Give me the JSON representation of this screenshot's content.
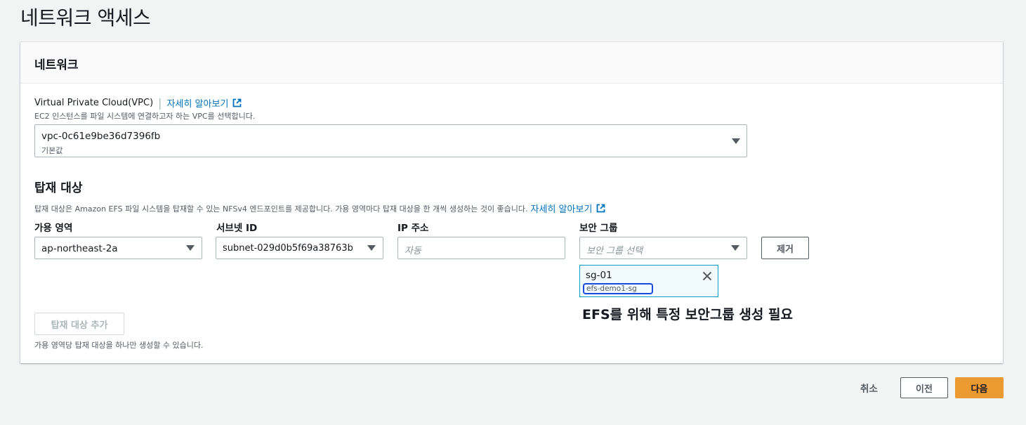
{
  "page": {
    "title": "네트워크 액세스"
  },
  "network": {
    "header": "네트워크",
    "vpc": {
      "label": "Virtual Private Cloud(VPC)",
      "learn_more": "자세히 알아보기",
      "description": "EC2 인스턴스를 파일 시스템에 연결하고자 하는 VPC를 선택합니다.",
      "value": "vpc-0c61e9be36d7396fb",
      "sublabel": "기본값"
    }
  },
  "mount_targets": {
    "title": "탑재 대상",
    "description": "탑재 대상은 Amazon EFS 파일 시스템을 탑재할 수 있는 NFSv4 엔드포인트를 제공합니다. 가용 영역마다 탑재 대상을 한 개씩 생성하는 것이 좋습니다.",
    "learn_more": "자세히 알아보기",
    "columns": {
      "az": "가용 영역",
      "subnet": "서브넷 ID",
      "ip": "IP 주소",
      "sg": "보안 그룹"
    },
    "row": {
      "az": "ap-northeast-2a",
      "subnet": "subnet-029d0b5f69a38763b",
      "ip_placeholder": "자동",
      "sg_placeholder": "보안 그룹 선택",
      "remove": "제거",
      "token": {
        "name": "sg-01",
        "description": "efs-demo1-sg"
      }
    },
    "annotation": "EFS를 위해 특정 보안그룹 생성 필요",
    "add_button": "탑재 대상 추가",
    "footnote": "가용 영역당 탑재 대상을 하나만 생성할 수 있습니다."
  },
  "footer": {
    "cancel": "취소",
    "previous": "이전",
    "next": "다음"
  },
  "colors": {
    "link": "#0073bb",
    "primary": "#ec7211",
    "highlight": "#1a4adb"
  }
}
